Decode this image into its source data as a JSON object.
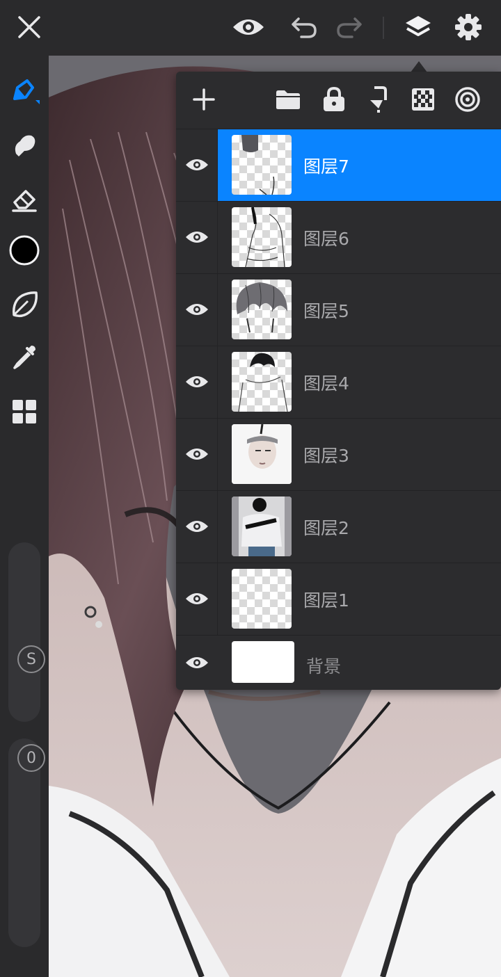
{
  "top_bar": {
    "icons": [
      "close-icon",
      "eye-icon",
      "undo-icon",
      "redo-icon",
      "layers-icon",
      "settings-icon"
    ]
  },
  "left_toolbar": {
    "tools": [
      "brush-icon",
      "smudge-icon",
      "eraser-icon",
      "color-swatch",
      "lasso-icon",
      "eyedropper-icon",
      "grid-icon"
    ],
    "active_tool": "brush-icon",
    "current_color": "#000000",
    "size_slider_label": "S",
    "opacity_slider_label": "0"
  },
  "layers_panel": {
    "toolbar_icons": [
      "add-icon",
      "folder-icon",
      "lock-icon",
      "merge-down-icon",
      "checker-icon",
      "target-icon"
    ],
    "layers": [
      {
        "name": "图层7",
        "visible": true,
        "selected": true
      },
      {
        "name": "图层6",
        "visible": true,
        "selected": false
      },
      {
        "name": "图层5",
        "visible": true,
        "selected": false
      },
      {
        "name": "图层4",
        "visible": true,
        "selected": false
      },
      {
        "name": "图层3",
        "visible": true,
        "selected": false
      },
      {
        "name": "图层2",
        "visible": true,
        "selected": false
      },
      {
        "name": "图层1",
        "visible": true,
        "selected": false
      }
    ],
    "background_layer": {
      "name": "背景",
      "visible": true
    }
  },
  "colors": {
    "accent": "#0a84ff",
    "panel_bg": "#2c2c2e",
    "toolbar_bg": "#2a2a2c"
  }
}
